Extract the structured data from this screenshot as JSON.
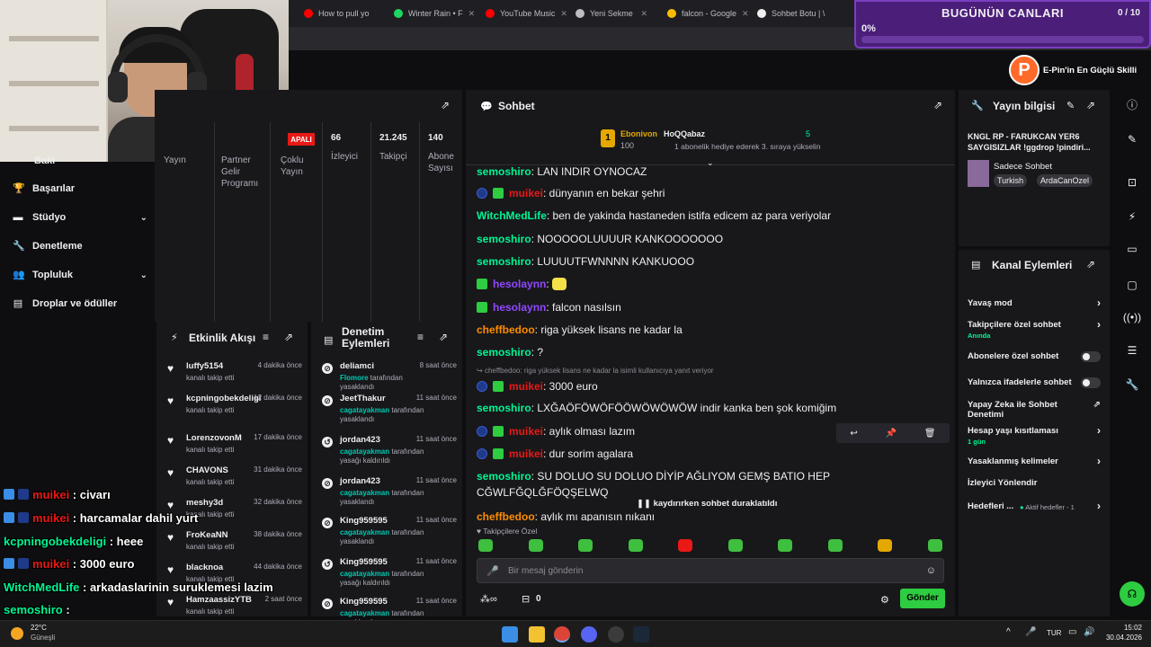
{
  "browser_tabs": [
    {
      "title": "How to pull yo",
      "color": "#ff0000"
    },
    {
      "title": "Winter Rain • F",
      "color": "#1ed760"
    },
    {
      "title": "YouTube Music",
      "color": "#ff0000"
    },
    {
      "title": "Yeni Sekme",
      "color": "#bdbdc4"
    },
    {
      "title": "falcon - Google",
      "color": "#fbbc04"
    },
    {
      "title": "Sohbet Botu | \\",
      "color": "#efeff1"
    }
  ],
  "goal": {
    "title": "BUGÜNÜN CANLARI",
    "count": "0 / 10",
    "percent": "0%"
  },
  "brand": {
    "logo": "P",
    "text": "E-Pin'in En Güçlü Skilli"
  },
  "sidebar": {
    "items": [
      {
        "label": "Başarılar",
        "icon": "trophy-icon"
      },
      {
        "label": "Stüdyo",
        "icon": "studio-icon"
      },
      {
        "label": "Denetleme",
        "icon": "wrench-icon"
      },
      {
        "label": "Topluluk",
        "icon": "community-icon"
      },
      {
        "label": "Droplar ve ödüller",
        "icon": "drops-icon"
      }
    ],
    "partial_top": "Baki"
  },
  "stats": {
    "badge": "APALI",
    "col1": "Yayın",
    "col2": [
      "Partner",
      "Gelir",
      "Programı"
    ],
    "col3": [
      "Çoklu",
      "Yayın"
    ],
    "viewers": {
      "value": "66",
      "label": "İzleyici"
    },
    "followers": {
      "value": "21.245",
      "label": "Takipçi"
    },
    "subs": {
      "value": "140",
      "label": [
        "Abone",
        "Sayısı"
      ]
    }
  },
  "activity": {
    "title": "Etkinlik Akışı",
    "items": [
      {
        "name": "luffy5154",
        "sub": "kanalı takip etti",
        "time": "4 dakika önce"
      },
      {
        "name": "kcpningobekdeligi",
        "sub": "kanalı takip etti",
        "time": "12 dakika önce"
      },
      {
        "name": "LorenzovonM",
        "sub": "kanalı takip etti",
        "time": "17 dakika önce"
      },
      {
        "name": "CHAVONS",
        "sub": "kanalı takip etti",
        "time": "31 dakika önce"
      },
      {
        "name": "meshy3d",
        "sub": "kanalı takip etti",
        "time": "32 dakika önce"
      },
      {
        "name": "FroKeaNN",
        "sub": "kanalı takip etti",
        "time": "38 dakika önce"
      },
      {
        "name": "blacknoa",
        "sub": "kanalı takip etti",
        "time": "44 dakika önce"
      },
      {
        "name": "HamzaassizYTB",
        "sub": "kanalı takip etti",
        "time": "2 saat önce"
      }
    ]
  },
  "moderation": {
    "title": [
      "Denetim",
      "Eylemleri"
    ],
    "items": [
      {
        "name": "deliamci",
        "actor": "Flomore",
        "sub": "tarafından yasaklandı",
        "time": "8 saat önce",
        "icon": "ban-icon"
      },
      {
        "name": "JeetThakur",
        "actor": "cagatayakman",
        "sub": "tarafından yasaklandı",
        "time": "11 saat önce",
        "icon": "ban-icon"
      },
      {
        "name": "jordan423",
        "actor": "cagatayakman",
        "sub": "tarafından yasağı kaldırıldı",
        "time": "11 saat önce",
        "icon": "unban-icon"
      },
      {
        "name": "jordan423",
        "actor": "cagatayakman",
        "sub": "tarafından yasaklandı",
        "time": "11 saat önce",
        "icon": "ban-icon"
      },
      {
        "name": "King959595",
        "actor": "cagatayakman",
        "sub": "tarafından yasaklandı",
        "time": "11 saat önce",
        "icon": "ban-icon"
      },
      {
        "name": "King959595",
        "actor": "cagatayakman",
        "sub": "tarafından yasağı kaldırıldı",
        "time": "11 saat önce",
        "icon": "unban-icon"
      },
      {
        "name": "King959595",
        "actor": "cagatayakman",
        "sub": "tarafından yasaklandı",
        "time": "11 saat önce",
        "icon": "ban-icon"
      },
      {
        "name": "King959595",
        "actor": "",
        "sub": "",
        "time": "11 saat önce",
        "icon": "ban-icon"
      }
    ]
  },
  "chat": {
    "title": "Sohbet",
    "leader1": {
      "name": "Ebonivon",
      "count": "100"
    },
    "leader2": {
      "name": "HoQQabaz",
      "count": "5",
      "sub": "1 abonelik hediye ederek 3. sıraya yükselin"
    },
    "messages": [
      {
        "user": "semoshiro",
        "color": "#00f593",
        "text": ": LAN INDIR OYNOCAZ",
        "badges": ""
      },
      {
        "user": "muikei",
        "color": "#e91916",
        "text": ": dünyanın en bekar şehri",
        "badges": "bg"
      },
      {
        "user": "WitchMedLife",
        "color": "#00f593",
        "text": ": ben de yakinda hastaneden istifa edicem az para veriyolar",
        "badges": ""
      },
      {
        "user": "semoshiro",
        "color": "#00f593",
        "text": ": NOOOOOLUUUUR KANKOOOOOOO",
        "badges": ""
      },
      {
        "user": "semoshiro",
        "color": "#00f593",
        "text": ": LUUUUTFWNNNN KANKUOOO",
        "badges": ""
      },
      {
        "user": "hesolaynn",
        "color": "#9147ff",
        "text": ":",
        "badges": "g",
        "emote": true
      },
      {
        "user": "hesolaynn",
        "color": "#9147ff",
        "text": ": falcon nasılsın",
        "badges": "g"
      },
      {
        "user": "cheffbedoo",
        "color": "#ff8c00",
        "text": ": riga yüksek lisans ne kadar la",
        "badges": ""
      },
      {
        "user": "semoshiro",
        "color": "#00f593",
        "text": ": ?",
        "badges": ""
      },
      {
        "user": "muikei",
        "color": "#e91916",
        "text": ": 3000 euro",
        "badges": "bg",
        "reply": "cheffbedoo: riga yüksek lisans ne kadar la isimli kullanıcıya yanıt veriyor"
      },
      {
        "user": "semoshiro",
        "color": "#00f593",
        "text": ": LXĞAÖFÖWÖFÖÖWÖWÖWÖW indir kanka ben şok komiğim",
        "badges": ""
      },
      {
        "user": "muikei",
        "color": "#e91916",
        "text": ": aylık olması lazım",
        "badges": "bg"
      },
      {
        "user": "muikei",
        "color": "#e91916",
        "text": ": dur sorim agalara",
        "badges": "bg"
      },
      {
        "user": "semoshiro",
        "color": "#00f593",
        "text": ": SU DOLUO SU DOLUO DİYİP AĞLIYOM GEMŞ BATIO HEP",
        "badges": ""
      },
      {
        "user": "",
        "color": "#00f593",
        "text": "CĞWLFĞQLĞFÖQŞELWQ",
        "badges": ""
      },
      {
        "user": "cheffbedoo",
        "color": "#ff8c00",
        "text": ": aylık mı apanısın nıkanı",
        "badges": ""
      }
    ],
    "paused": "kaydırırken sohbet duraklatıldı",
    "followers_only": "Takipçilere Özel",
    "input_placeholder": "Bir mesaj gönderin",
    "points": "0",
    "send": "Gönder"
  },
  "stream_info": {
    "title": "Yayın bilgisi",
    "stream_title": "KNGL RP - FARUKCAN YER6 SAYGISIZLAR !ggdrop !pindiri...",
    "category": "Sadece Sohbet",
    "tags": [
      "Turkish",
      "ArdaCanOzel"
    ]
  },
  "channel_actions": {
    "title": "Kanal Eylemleri",
    "items": [
      {
        "label": "Yavaş mod",
        "type": "chev"
      },
      {
        "label": "Takipçilere özel sohbet",
        "sub": "Anında",
        "type": "chev"
      },
      {
        "label": "Abonelere özel sohbet",
        "type": "toggle"
      },
      {
        "label": "Yalnızca ifadelerle sohbet",
        "type": "toggle"
      },
      {
        "label": "Yapay Zeka ile Sohbet Denetimi",
        "type": "ext"
      },
      {
        "label": "Hesap yaşı kısıtlaması",
        "sub": "1 gün",
        "type": "chev"
      },
      {
        "label": "Yasaklanmış kelimeler",
        "type": "chev"
      },
      {
        "label": "İzleyici Yönlendir",
        "type": "none"
      },
      {
        "label": "Hedefleri ...",
        "sub2": "Aktif hedefler - 1",
        "type": "chev"
      }
    ]
  },
  "overlay_chat": [
    {
      "user": "muikei",
      "color": "#e91916",
      "text": " : civarı",
      "icons": true
    },
    {
      "user": "muikei",
      "color": "#e91916",
      "text": " : harcamalar dahil yurt",
      "icons": true
    },
    {
      "user": "kcpningobekdeligi",
      "color": "#00f593",
      "text": " : heee",
      "icons": false
    },
    {
      "user": "muikei",
      "color": "#e91916",
      "text": " : 3000 euro",
      "icons": true
    },
    {
      "user": "WitchMedLife",
      "color": "#00f593",
      "text": " : arkadaslarinin suruklemesi lazim",
      "icons": false
    },
    {
      "user": "semoshiro",
      "color": "#00f593",
      "text": " :",
      "icons": false
    }
  ],
  "taskbar": {
    "weather_temp": "22°C",
    "weather_desc": "Güneşli",
    "lang": "TUR",
    "time": "15:02",
    "date": "30.04.2026"
  }
}
